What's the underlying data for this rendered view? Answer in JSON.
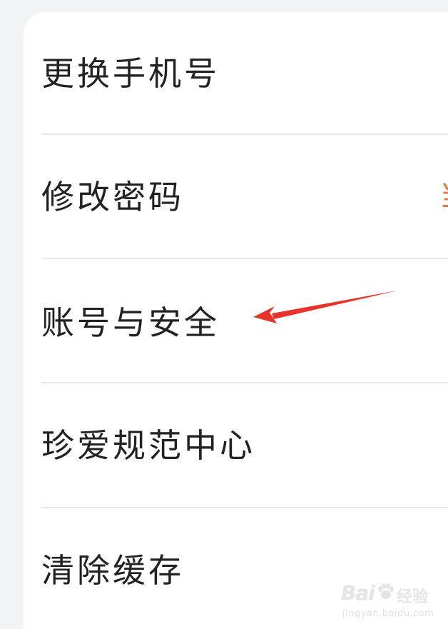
{
  "settings_menu": {
    "items": [
      {
        "label": "更换手机号"
      },
      {
        "label": "修改密码",
        "trailing_partial": "当"
      },
      {
        "label": "账号与安全",
        "highlighted": true
      },
      {
        "label": "珍爱规范中心"
      },
      {
        "label": "清除缓存"
      }
    ]
  },
  "annotation": {
    "type": "arrow",
    "color": "#e8332a",
    "points_to": "账号与安全"
  },
  "watermark": {
    "brand": "Bai",
    "suffix": "经验",
    "domain": "jingyan.baidu.com"
  },
  "colors": {
    "background": "#f2f3f5",
    "card": "#ffffff",
    "text": "#222222",
    "divider": "#e8e8e8",
    "accent": "#e9773a"
  }
}
